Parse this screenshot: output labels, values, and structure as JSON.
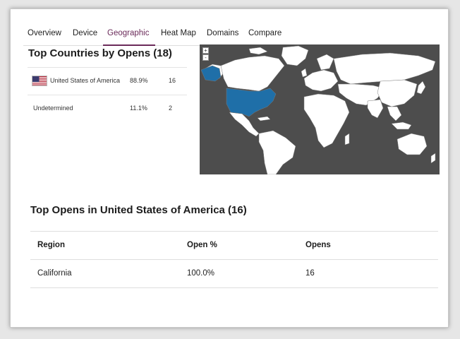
{
  "tabs": [
    {
      "label": "Overview"
    },
    {
      "label": "Device"
    },
    {
      "label": "Geographic"
    },
    {
      "label": "Heat Map"
    },
    {
      "label": "Domains"
    },
    {
      "label": "Compare"
    }
  ],
  "active_tab": "Geographic",
  "countries": {
    "title": "Top Countries by Opens (18)",
    "rows": [
      {
        "name": "United States of America",
        "percent": "88.9%",
        "opens": "16",
        "flag": "us-flag-icon"
      },
      {
        "name": "Undetermined",
        "percent": "11.1%",
        "opens": "2"
      }
    ]
  },
  "map": {
    "zoom_in": "+",
    "zoom_out": "-",
    "ocean_color": "#4d4d4d",
    "land_color": "#ffffff",
    "highlight_color": "#1f6fa8",
    "highlighted_country": "United States of America"
  },
  "regions": {
    "title": "Top Opens in United States of America (16)",
    "headers": {
      "region": "Region",
      "percent": "Open %",
      "opens": "Opens"
    },
    "rows": [
      {
        "region": "California",
        "percent": "100.0%",
        "opens": "16"
      }
    ]
  },
  "colors": {
    "accent": "#6b2b5a"
  }
}
